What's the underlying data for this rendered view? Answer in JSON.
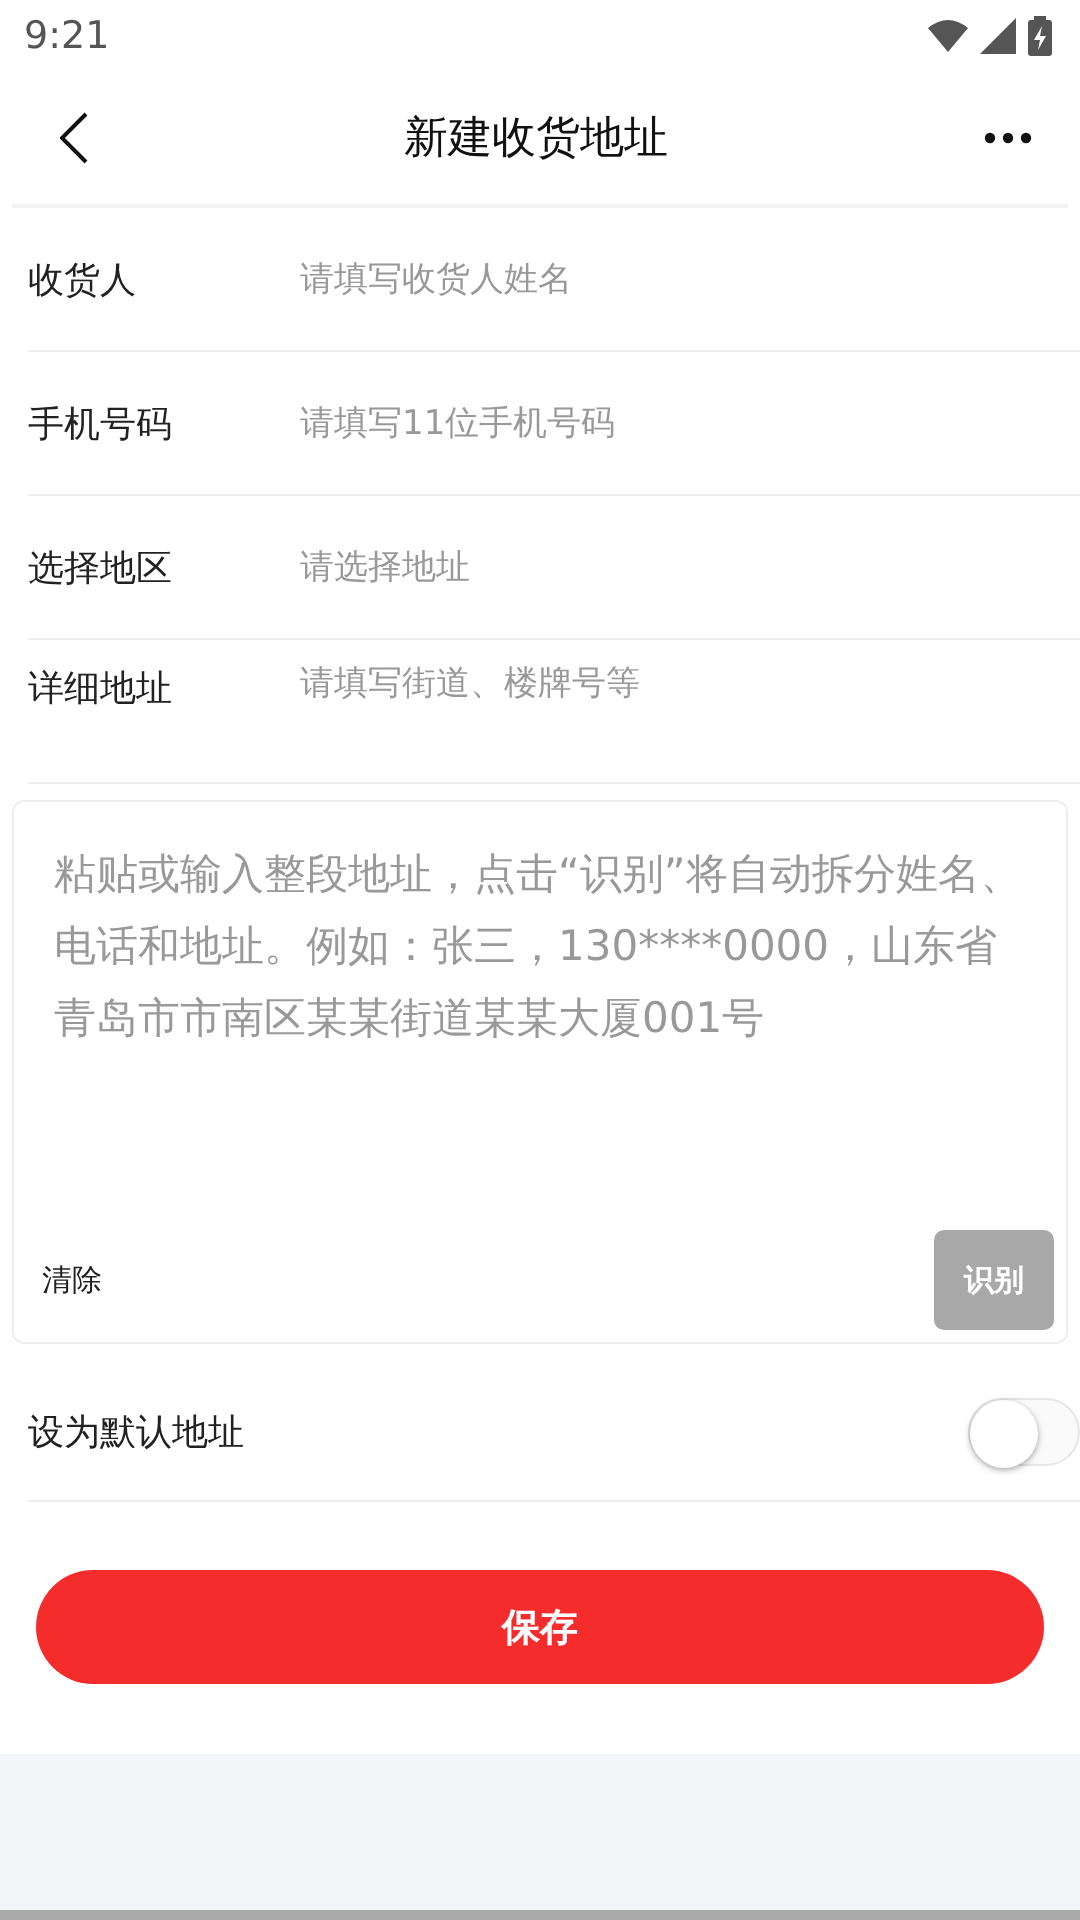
{
  "status_bar": {
    "time": "9:21"
  },
  "header": {
    "title": "新建收货地址"
  },
  "fields": [
    {
      "label": "收货人",
      "placeholder": "请填写收货人姓名"
    },
    {
      "label": "手机号码",
      "placeholder": "请填写11位手机号码"
    },
    {
      "label": "选择地区",
      "placeholder": "请选择地址"
    },
    {
      "label": "详细地址",
      "placeholder": "请填写街道、楼牌号等"
    }
  ],
  "smart_paste": {
    "placeholder": "粘贴或输入整段地址，点击“识别”将自动拆分姓名、电话和地址。例如：张三，130****0000，山东省青岛市市南区某某街道某某大厦001号",
    "clear_label": "清除",
    "recognize_label": "识别",
    "recognize_disabled": true
  },
  "default_toggle": {
    "label": "设为默认地址",
    "on": false
  },
  "save_button": {
    "label": "保存"
  }
}
